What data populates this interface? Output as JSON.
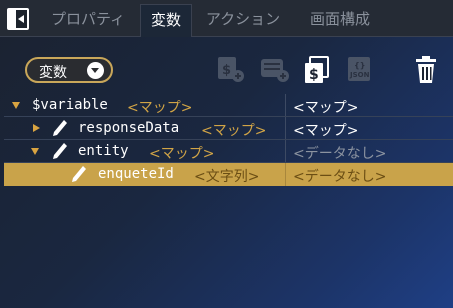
{
  "tabs": [
    {
      "label": "プロパティ",
      "active": false
    },
    {
      "label": "変数",
      "active": true
    },
    {
      "label": "アクション",
      "active": false
    },
    {
      "label": "画面構成",
      "active": false
    }
  ],
  "toolbar": {
    "dropdown_label": "変数",
    "tools": [
      {
        "icon": "add-variable-icon",
        "enabled": false
      },
      {
        "icon": "add-database-variable-icon",
        "enabled": false
      },
      {
        "icon": "copy-variable-icon",
        "enabled": true
      },
      {
        "icon": "json-icon",
        "text": "JSON",
        "enabled": false
      },
      {
        "icon": "trash-icon",
        "enabled": true
      }
    ]
  },
  "variables": [
    {
      "name": "$variable",
      "type": "<マップ>",
      "value": "<マップ>",
      "expanded": true,
      "has_pen": false
    },
    {
      "name": "responseData",
      "type": "<マップ>",
      "value": "<マップ>",
      "expanded": false,
      "has_pen": true
    },
    {
      "name": "entity",
      "type": "<マップ>",
      "value": "<データなし>",
      "expanded": true,
      "has_pen": true
    },
    {
      "name": "enqueteId",
      "type": "<文字列>",
      "value": "<データなし>",
      "selected": true,
      "has_pen": true
    }
  ],
  "colors": {
    "accent": "#d2a546",
    "selected_row": "#c9a34a",
    "tab_bar": "#252b35"
  }
}
